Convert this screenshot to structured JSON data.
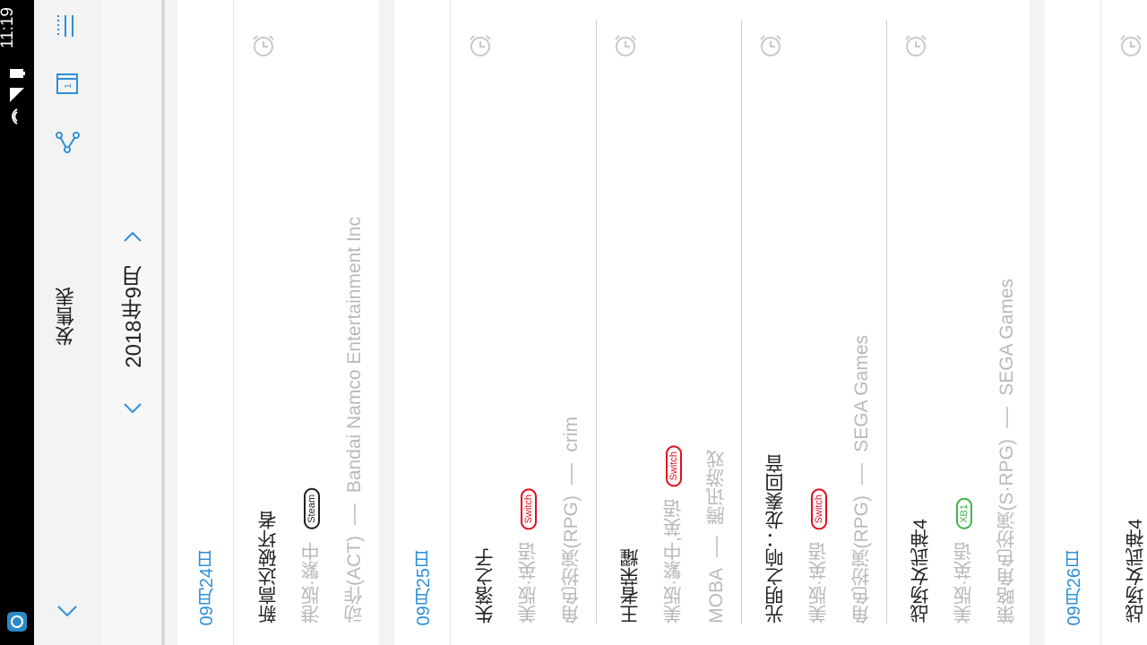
{
  "status_bar": {
    "time": "11:19"
  },
  "toolbar": {
    "icons": [
      "menu-list-icon",
      "calendar-icon",
      "share-icon",
      "chevron-down-icon"
    ],
    "calendar_day": "1"
  },
  "header": {
    "title": "发售表",
    "month": "2018年9月"
  },
  "days": [
    {
      "date": "09月24日",
      "games": [
        {
          "name": "新高达破坏者",
          "region_lang": "港版·繁中",
          "platform": "Steam",
          "genre": "动作(ACT)",
          "publisher": "Bandai Namco Entertainment Inc"
        }
      ]
    },
    {
      "date": "09月25日",
      "games": [
        {
          "name": "失落之子",
          "region_lang": "美版·英语",
          "platform": "Switch",
          "genre": "角色扮演(RPG)",
          "publisher": "crim"
        },
        {
          "name": "王者荣耀",
          "region_lang": "美版·繁中,英语",
          "platform": "Switch",
          "genre": "MOBA",
          "publisher": "腾讯游戏"
        },
        {
          "name": "光明之响：龙奏回音",
          "region_lang": "美版·英语",
          "platform": "Switch",
          "genre": "角色扮演(RPG)",
          "publisher": "SEGA Games"
        },
        {
          "name": "战场女武神4",
          "region_lang": "美版·英语",
          "platform": "XB1",
          "genre": "策略角色扮演(S·RPG)",
          "publisher": "SEGA Games"
        }
      ]
    },
    {
      "date": "09月26日",
      "games": [
        {
          "name": "战场女武神4"
        }
      ]
    }
  ],
  "colors": {
    "accent": "#2e8fd8",
    "switch": "#e0101f",
    "xb1": "#3fb54b",
    "muted": "#b9b9b9"
  }
}
